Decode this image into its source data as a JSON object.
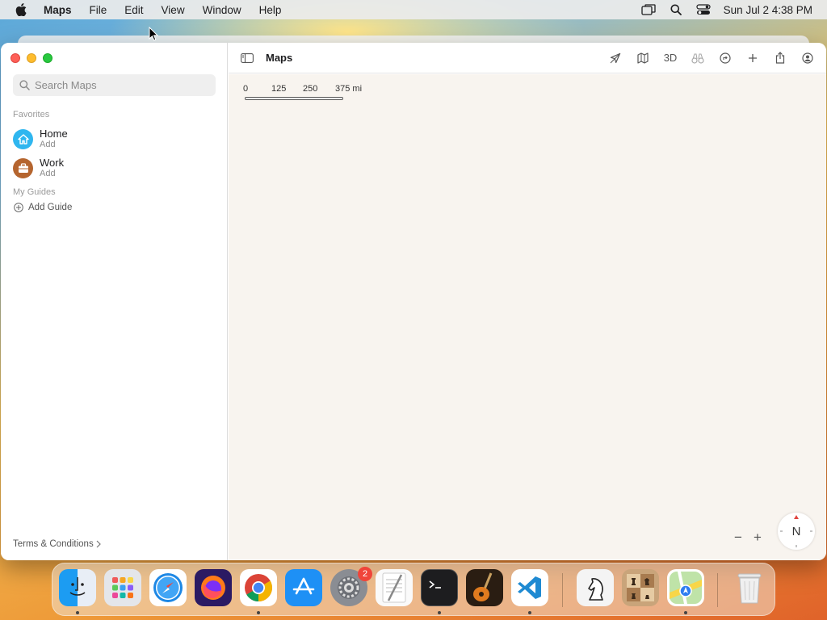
{
  "menubar": {
    "app_name": "Maps",
    "items": [
      "File",
      "Edit",
      "View",
      "Window",
      "Help"
    ],
    "clock": "Sun Jul 2  4:38 PM"
  },
  "window": {
    "toolbar_title": "Maps",
    "toolbar_3d": "3D"
  },
  "search": {
    "placeholder": "Search Maps"
  },
  "sidebar": {
    "favorites_title": "Favorites",
    "favorites": [
      {
        "name": "Home",
        "sub": "Add",
        "icon": "house-icon",
        "color": "#2fb6ef"
      },
      {
        "name": "Work",
        "sub": "Add",
        "icon": "briefcase-icon",
        "color": "#b5652f"
      }
    ],
    "guides_title": "My Guides",
    "add_guide": "Add Guide",
    "terms": "Terms & Conditions"
  },
  "map": {
    "scale_labels": [
      "0",
      "125",
      "250",
      "375 mi"
    ],
    "compass": "N",
    "zoom_out": "−",
    "zoom_in": "+"
  },
  "dock": {
    "apps": [
      {
        "name": "Finder",
        "icon": "finder-icon",
        "running": true
      },
      {
        "name": "Launchpad",
        "icon": "launchpad-icon",
        "running": false
      },
      {
        "name": "Safari",
        "icon": "safari-icon",
        "running": false
      },
      {
        "name": "Firefox",
        "icon": "firefox-icon",
        "running": false
      },
      {
        "name": "Chrome",
        "icon": "chrome-icon",
        "running": true
      },
      {
        "name": "App Store",
        "icon": "appstore-icon",
        "running": false
      },
      {
        "name": "System Settings",
        "icon": "settings-icon",
        "running": false,
        "badge": "2"
      },
      {
        "name": "TextEdit",
        "icon": "textedit-icon",
        "running": false
      },
      {
        "name": "Terminal",
        "icon": "terminal-icon",
        "running": true
      },
      {
        "name": "GarageBand",
        "icon": "garageband-icon",
        "running": false
      },
      {
        "name": "VS Code",
        "icon": "vscode-icon",
        "running": true
      },
      {
        "name": "Chess",
        "icon": "chess-icon",
        "running": false
      },
      {
        "name": "Chess Board",
        "icon": "chessboard-icon",
        "running": false
      },
      {
        "name": "Maps",
        "icon": "maps-icon",
        "running": true
      },
      {
        "name": "Trash",
        "icon": "trash-icon",
        "running": false
      }
    ]
  }
}
